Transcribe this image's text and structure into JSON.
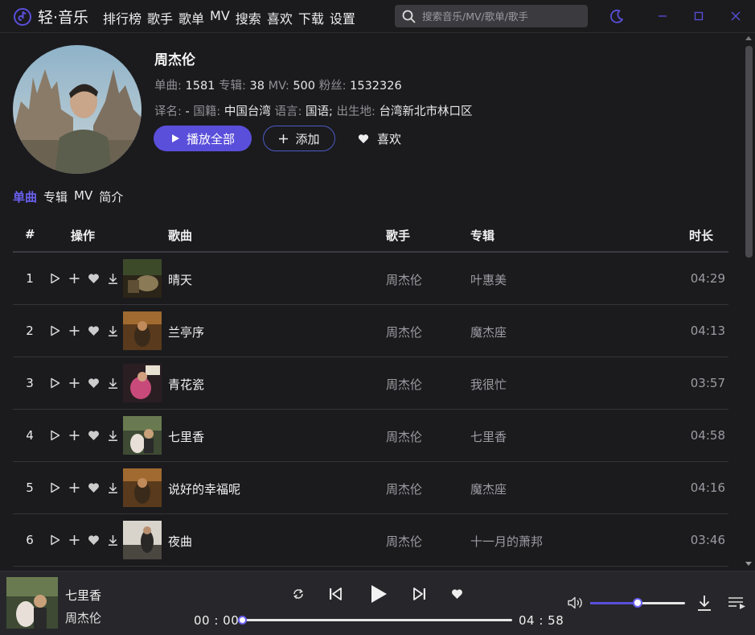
{
  "app": {
    "name": "轻·音乐",
    "accent": "#5a4fdb"
  },
  "nav": [
    "排行榜",
    "歌手",
    "歌单",
    "MV",
    "搜索",
    "喜欢",
    "下载",
    "设置"
  ],
  "search": {
    "placeholder": "搜索音乐/MV/歌单/歌手"
  },
  "artist": {
    "name": "周杰伦",
    "stats": {
      "songs_label": "单曲:",
      "songs": "1581",
      "albums_label": "专辑:",
      "albums": "38",
      "mv_label": "MV:",
      "mv": "500",
      "fans_label": "粉丝:",
      "fans": "1532326"
    },
    "info": {
      "alias_label": "译名:",
      "alias": "-",
      "nationality_label": "国籍:",
      "nationality": "中国台湾",
      "language_label": "语言:",
      "language": "国语;",
      "birthplace_label": "出生地:",
      "birthplace": "台湾新北市林口区"
    },
    "buttons": {
      "play_all": "播放全部",
      "add": "添加",
      "like": "喜欢"
    }
  },
  "tabs": [
    {
      "label": "单曲",
      "active": true
    },
    {
      "label": "专辑",
      "active": false
    },
    {
      "label": "MV",
      "active": false
    },
    {
      "label": "简介",
      "active": false
    }
  ],
  "table": {
    "headers": {
      "index": "#",
      "ops": "操作",
      "song": "歌曲",
      "singer": "歌手",
      "album": "专辑",
      "duration": "时长"
    },
    "rows": [
      {
        "index": "1",
        "title": "晴天",
        "singer": "周杰伦",
        "album": "叶惠美",
        "duration": "04:29"
      },
      {
        "index": "2",
        "title": "兰亭序",
        "singer": "周杰伦",
        "album": "魔杰座",
        "duration": "04:13"
      },
      {
        "index": "3",
        "title": "青花瓷",
        "singer": "周杰伦",
        "album": "我很忙",
        "duration": "03:57"
      },
      {
        "index": "4",
        "title": "七里香",
        "singer": "周杰伦",
        "album": "七里香",
        "duration": "04:58"
      },
      {
        "index": "5",
        "title": "说好的幸福呢",
        "singer": "周杰伦",
        "album": "魔杰座",
        "duration": "04:16"
      },
      {
        "index": "6",
        "title": "夜曲",
        "singer": "周杰伦",
        "album": "十一月的萧邦",
        "duration": "03:46"
      }
    ]
  },
  "player": {
    "title": "七里香",
    "artist": "周杰伦",
    "current_time": "00 : 00",
    "total_time": "04 : 58",
    "progress": 0,
    "volume": 0.5
  }
}
